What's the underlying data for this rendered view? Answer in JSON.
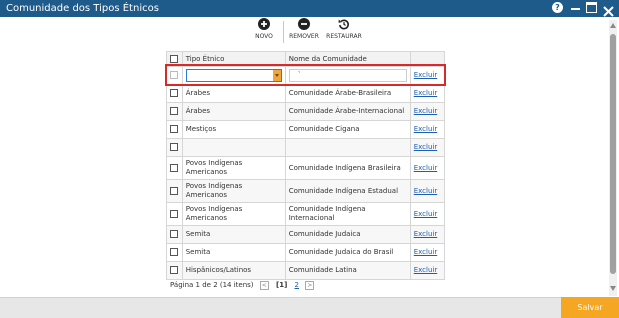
{
  "window": {
    "title": "Comunidade dos Tipos Étnicos",
    "help_label": "?"
  },
  "toolbar": {
    "new_label": "NOVO",
    "remove_label": "REMOVER",
    "restore_label": "RESTAURAR"
  },
  "table": {
    "headers": [
      "Tipo Étnico",
      "Nome da Comunidade"
    ],
    "edit_row": {
      "tipo_value": "",
      "nome_value": "`",
      "action": "Excluir"
    },
    "rows": [
      {
        "tipo": "Árabes",
        "nome": "Comunidade Árabe-Brasileira",
        "action": "Excluir"
      },
      {
        "tipo": "Árabes",
        "nome": "Comunidade Árabe-Internacional",
        "action": "Excluir"
      },
      {
        "tipo": "Mestiços",
        "nome": "Comunidade Cigana",
        "action": "Excluir"
      },
      {
        "tipo": "",
        "nome": "",
        "action": "Excluir"
      },
      {
        "tipo": "Povos Indígenas Americanos",
        "nome": "Comunidade Indígena Brasileira",
        "action": "Excluir"
      },
      {
        "tipo": "Povos Indígenas Americanos",
        "nome": "Comunidade Indígena Estadual",
        "action": "Excluir"
      },
      {
        "tipo": "Povos Indígenas Americanos",
        "nome": "Comunidade Indígena Internacional",
        "action": "Excluir"
      },
      {
        "tipo": "Semita",
        "nome": "Comunidade Judaica",
        "action": "Excluir"
      },
      {
        "tipo": "Semita",
        "nome": "Comunidade Judaica do Brasil",
        "action": "Excluir"
      },
      {
        "tipo": "Hispânicos/Latinos",
        "nome": "Comunidade Latina",
        "action": "Excluir"
      }
    ]
  },
  "pager": {
    "summary": "Página 1 de 2 (14 itens)",
    "prev": "<",
    "current": "[1]",
    "page2": "2",
    "next": ">"
  },
  "footer": {
    "save_label": "Salvar"
  },
  "colors": {
    "titlebar": "#1e5a8a",
    "save": "#f5a623",
    "highlight": "#d72a2a",
    "link": "#1a5fb4"
  }
}
